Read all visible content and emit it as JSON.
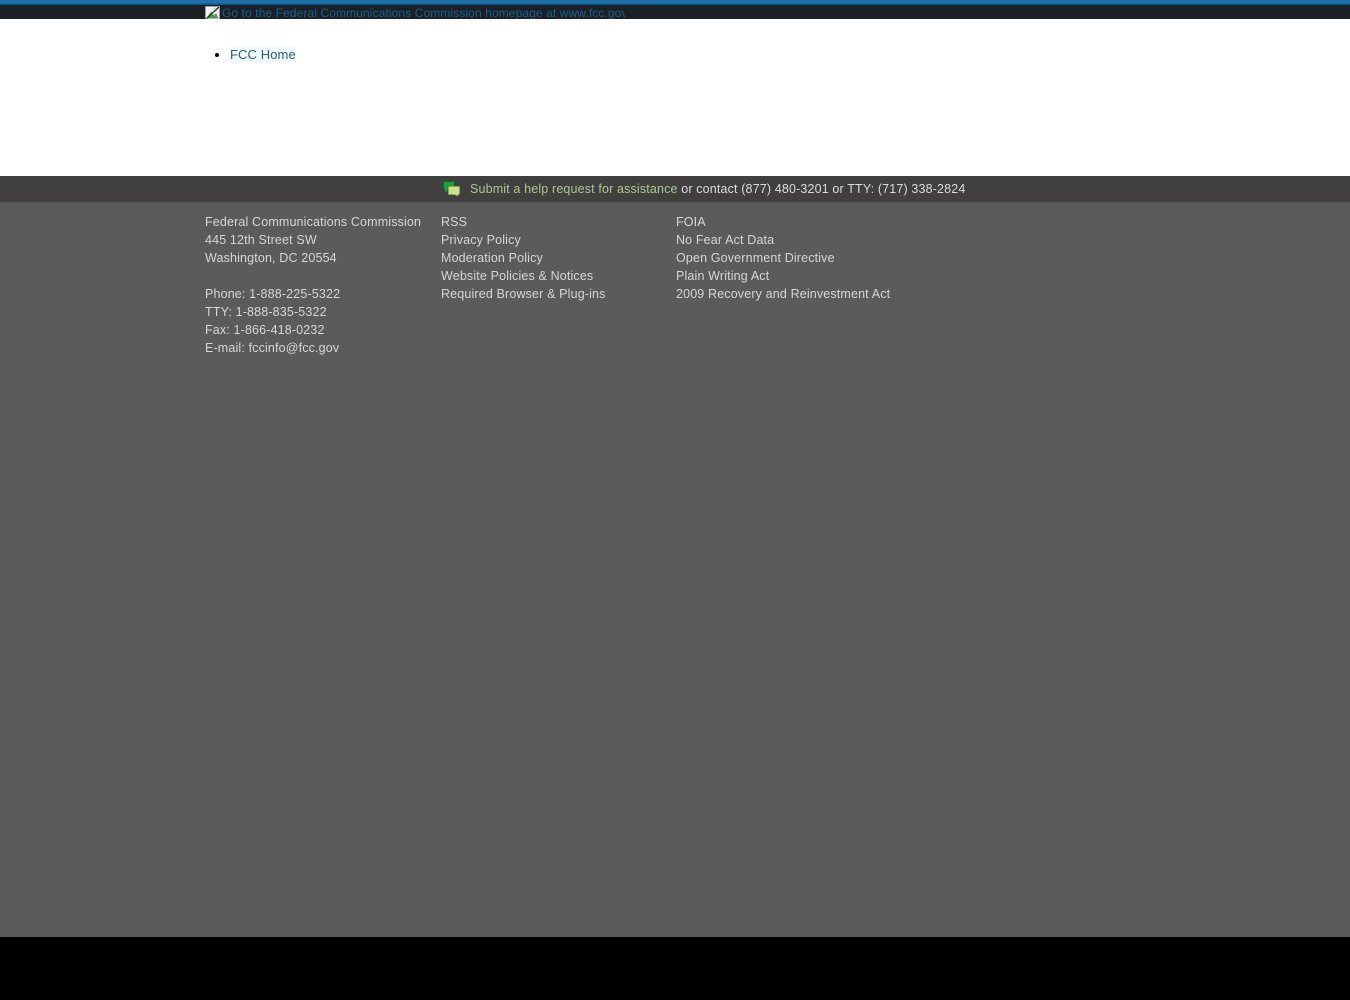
{
  "header": {
    "logo_alt": "Go to the Federal Communications Commission homepage at www.fcc.gov",
    "logo_icon": "broken-image-icon"
  },
  "content": {
    "nav_items": [
      {
        "label": "FCC Home"
      }
    ]
  },
  "help_bar": {
    "icon": "chat-bubble-icon",
    "link_label": "Submit a help request for assistance",
    "rest_text": " or contact (877) 480-3201 or TTY: (717) 338-2824"
  },
  "footer": {
    "address_column": {
      "lines": [
        "Federal Communications Commission",
        "445 12th Street SW",
        "Washington, DC 20554"
      ],
      "contact": [
        "Phone: 1-888-225-5322",
        "TTY: 1-888-835-5322",
        "Fax: 1-866-418-0232",
        "E-mail: fccinfo@fcc.gov"
      ]
    },
    "links_column": [
      {
        "label": "RSS"
      },
      {
        "label": "Privacy Policy"
      },
      {
        "label": "Moderation Policy"
      },
      {
        "label": "Website Policies & Notices"
      },
      {
        "label": "Required Browser & Plug-ins"
      }
    ],
    "gov_column": [
      {
        "label": "FOIA"
      },
      {
        "label": "No Fear Act Data"
      },
      {
        "label": "Open Government Directive"
      },
      {
        "label": "Plain Writing Act"
      },
      {
        "label": "2009 Recovery and Reinvestment Act"
      }
    ]
  },
  "colors": {
    "top_strip": "#1e76b0",
    "header_bg": "#1b2026",
    "alt_text": "#17618f",
    "help_bar_bg": "#413f3f",
    "help_link": "#a9c98c",
    "footer_bg": "#5b5b5b",
    "footer_text": "#d6d6d6",
    "nav_link": "#2e5f73",
    "bottom_bar": "#000000"
  }
}
